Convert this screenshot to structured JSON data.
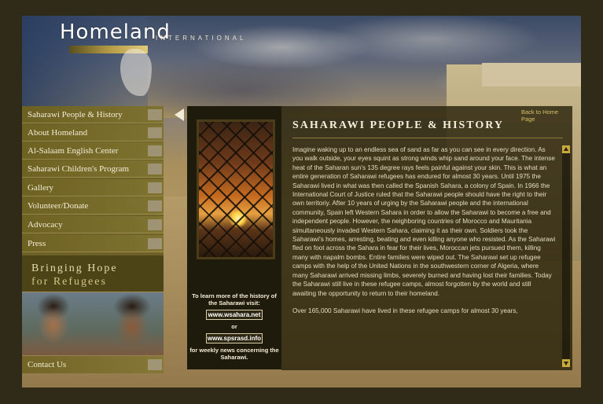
{
  "branding": {
    "title": "Homeland",
    "subtitle": "INTERNATIONAL"
  },
  "nav": {
    "items": [
      {
        "label": "Saharawi People & History"
      },
      {
        "label": "About Homeland"
      },
      {
        "label": "Al-Salaam English Center"
      },
      {
        "label": "Saharawi Children's Program"
      },
      {
        "label": "Gallery"
      },
      {
        "label": "Volunteer/Donate"
      },
      {
        "label": "Advocacy"
      },
      {
        "label": "Press"
      }
    ],
    "contact": "Contact Us"
  },
  "slogan": {
    "line1": "Bringing Hope",
    "line2": "for Refugees"
  },
  "history_info": {
    "intro": "To learn more of the history of the Saharawi visit:",
    "link1": "www.wsahara.net",
    "or": "or",
    "link2": "www.spsrasd.info",
    "outro": "for weekly news concerning the Saharawi."
  },
  "panel": {
    "back_link": "Back to Home Page",
    "title": "SAHARAWI PEOPLE & HISTORY",
    "paragraph1": "Imagine waking up to an endless sea of sand as far as you can see in every direction.  As you walk outside, your eyes squint as strong winds whip sand around your face.  The intense heat of the Saharan sun's 135 degree rays feels painful against your skin. This is what an entire generation of Saharawi refugees has endured for almost 30 years.  Until 1975 the Saharawi lived in what was then called the Spanish Sahara, a colony of Spain.  In 1966 the International Court of Justice ruled that the Saharawi people should have the right to their own territoriy.  After 10 years of urging by the Saharawi people and the international community, Spain left Western Sahara in order to allow the Saharawi to become a free and independent people. However, the neighboring countries of Morocco and Mauritania simultaneously invaded Western Sahara, claiming it as their own. Soldiers took the Saharawi's homes, arresting, beating and even  killing anyone who  resisted.  As the Saharawi fled on foot across the Sahara in fear for their lives, Moroccan jets pursued them, killing many with napalm bombs. Entire families were wiped out. The Saharawi set up refugee camps with the help of the United Nations in the southwestern corner of Algeria, where many Saharawi arrived missing limbs, severely burned and having lost their families. Today the Saharawi still live in these refugee camps, almost forgotten by the world and still awaiting the opportunity to return to their homeland.",
    "paragraph2": "Over 165,000 Saharawi have lived in these refugee camps for almost 30 years,"
  },
  "colors": {
    "nav_background": "#6e6222",
    "panel_background": "#2a230c",
    "accent_gold": "#c9a93c",
    "page_border": "#2f2b18"
  },
  "icons": [
    "pointer-arrow-icon",
    "scroll-up-icon",
    "scroll-down-icon",
    "africa-map-icon"
  ]
}
